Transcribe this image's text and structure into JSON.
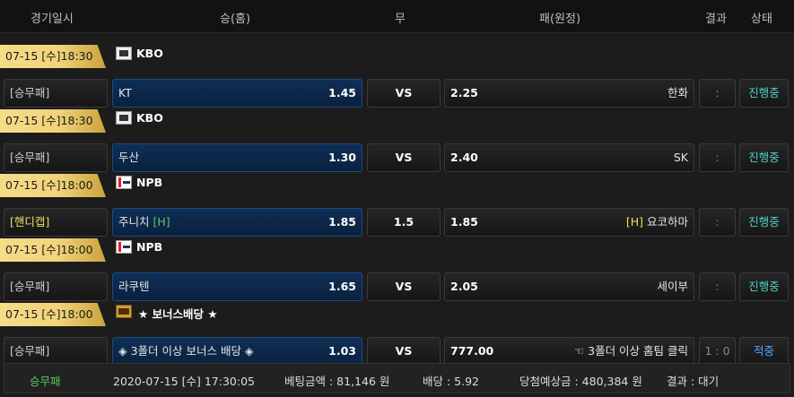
{
  "header": {
    "date": "경기일시",
    "home": "승(홈)",
    "draw": "무",
    "away": "패(원정)",
    "result": "결과",
    "status": "상태"
  },
  "matches": [
    {
      "datetime": "07-15 [수]18:30",
      "league_icon": "kbo-logo-icon",
      "league": "KBO",
      "type": "[승무패]",
      "home": "KT",
      "home_odds": "1.45",
      "mid": "VS",
      "away_odds": "2.25",
      "away": "한화",
      "result": ":",
      "status": "진행중"
    },
    {
      "datetime": "07-15 [수]18:30",
      "league_icon": "kbo-logo-icon",
      "league": "KBO",
      "type": "[승무패]",
      "home": "두산",
      "home_odds": "1.30",
      "mid": "VS",
      "away_odds": "2.40",
      "away": "SK",
      "result": ":",
      "status": "진행중"
    },
    {
      "datetime": "07-15 [수]18:00",
      "league_icon": "npb-logo-icon",
      "league": "NPB",
      "type": "[핸디캡]",
      "home": "주니치",
      "home_tag": "[H]",
      "home_odds": "1.85",
      "mid": "1.5",
      "away_odds": "1.85",
      "away_tag": "[H]",
      "away": "요코하마",
      "result": ":",
      "status": "진행중"
    },
    {
      "datetime": "07-15 [수]18:00",
      "league_icon": "npb-logo-icon",
      "league": "NPB",
      "type": "[승무패]",
      "home": "라쿠텐",
      "home_odds": "1.65",
      "mid": "VS",
      "away_odds": "2.05",
      "away": "세이부",
      "result": ":",
      "status": "진행중"
    },
    {
      "datetime": "07-15 [수]18:00",
      "league_icon": "bonus-logo-icon",
      "league": "★ 보너스배당 ★",
      "type": "[승무패]",
      "home": "◈ 3폴더 이상 보너스 배당 ◈",
      "home_odds": "1.03",
      "mid": "VS",
      "away_odds": "777.00",
      "away": "☜ 3폴더 이상 홈팀 클릭",
      "result": "1 : 0",
      "status": "적중"
    }
  ],
  "footer": {
    "type": "승무패",
    "datetime": "2020-07-15 [수] 17:30:05",
    "bet_amount": "베팅금액 : 81,146 원",
    "odds": "배당 : 5.92",
    "expected": "당첨예상금 : 480,384 원",
    "result": "결과 : 대기"
  },
  "colors": {
    "accent_gold": "#f2d37a",
    "home_blue": "#0f2f55",
    "status_teal": "#4fd0c0",
    "status_blue": "#4aa8ff"
  }
}
